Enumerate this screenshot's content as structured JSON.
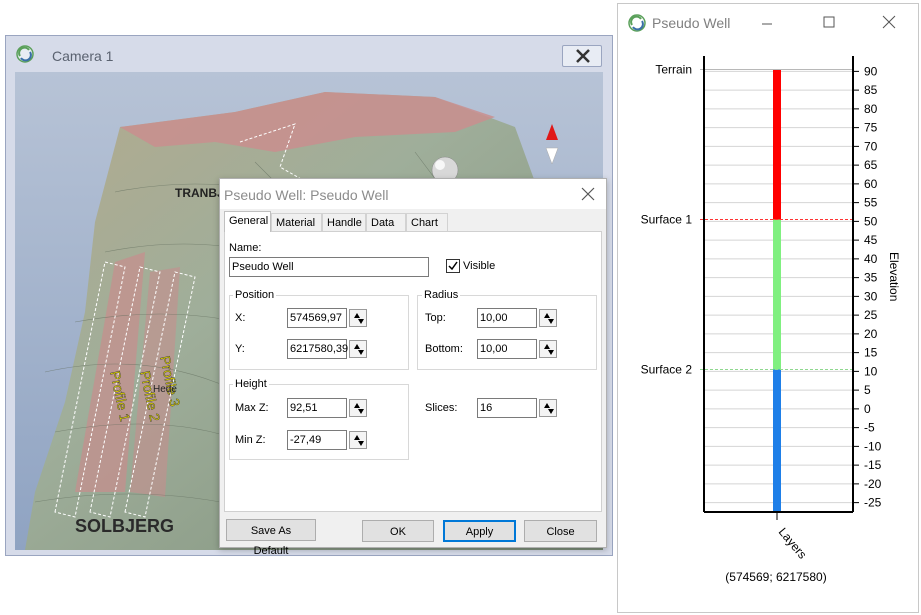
{
  "camera_window": {
    "title": "Camera 1",
    "map_labels": [
      "TRANBJERG",
      "SOLBJERG",
      "Hede",
      "Profile 1",
      "Profile 2",
      "Profile 3"
    ]
  },
  "well_window": {
    "title": "Pseudo Well"
  },
  "dialog": {
    "title": "Pseudo Well: Pseudo Well",
    "tabs": [
      "General",
      "Material",
      "Handle",
      "Data",
      "Chart"
    ],
    "active_tab": "General",
    "name_label": "Name:",
    "name_value": "Pseudo Well",
    "visible_label": "Visible",
    "visible_checked": true,
    "position": {
      "label": "Position",
      "x_label": "X:",
      "x_value": "574569,97",
      "y_label": "Y:",
      "y_value": "6217580,39"
    },
    "radius": {
      "label": "Radius",
      "top_label": "Top:",
      "top_value": "10,00",
      "bottom_label": "Bottom:",
      "bottom_value": "10,00"
    },
    "height": {
      "label": "Height",
      "maxz_label": "Max Z:",
      "maxz_value": "92,51",
      "minz_label": "Min Z:",
      "minz_value": "-27,49"
    },
    "slices_label": "Slices:",
    "slices_value": "16",
    "buttons": {
      "save_default": "Save As Default",
      "ok": "OK",
      "apply": "Apply",
      "close": "Close"
    }
  },
  "chart_data": {
    "type": "bar",
    "ylabel": "Elevation",
    "xlabel": "Layers",
    "footer": "(574569; 6217580)",
    "ylim": [
      -27.5,
      92.5
    ],
    "yticks": [
      90,
      85,
      80,
      75,
      70,
      65,
      60,
      55,
      50,
      45,
      40,
      35,
      30,
      25,
      20,
      15,
      10,
      5,
      0,
      -5,
      -10,
      -15,
      -20,
      -25
    ],
    "grid": true,
    "boundaries": [
      {
        "name": "Terrain",
        "elevation": 90.5
      },
      {
        "name": "Surface 1",
        "elevation": 50.5
      },
      {
        "name": "Surface 2",
        "elevation": 10.5
      }
    ],
    "layers": [
      {
        "top": 90.5,
        "bottom": 50.5,
        "color": "#ff0000"
      },
      {
        "top": 50.5,
        "bottom": 10.5,
        "color": "#80f080"
      },
      {
        "top": 10.5,
        "bottom": -27.5,
        "color": "#1e7fe8"
      }
    ]
  }
}
